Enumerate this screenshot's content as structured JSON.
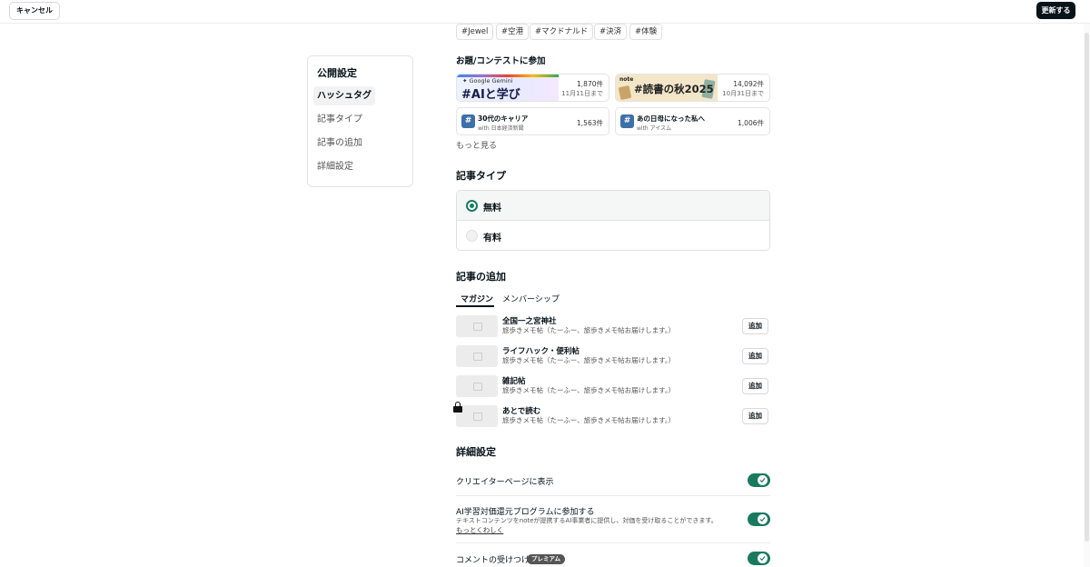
{
  "header": {
    "cancel_label": "キャンセル",
    "update_label": "更新する"
  },
  "sidebar": {
    "title": "公開設定",
    "items": [
      {
        "label": "ハッシュタグ",
        "active": true
      },
      {
        "label": "記事タイプ",
        "active": false
      },
      {
        "label": "記事の追加",
        "active": false
      },
      {
        "label": "詳細設定",
        "active": false
      }
    ]
  },
  "hashtags": [
    "#Jewel",
    "#空港",
    "#マクドナルド",
    "#決済",
    "#体験"
  ],
  "contests": {
    "title": "お題/コンテストに参加",
    "featured": [
      {
        "banner_sub": "Google Gemini",
        "banner_title": "#AIと学び",
        "count": "1,870件",
        "deadline": "11月11日まで"
      },
      {
        "banner_logo": "note",
        "banner_title": "#読書の秋2025",
        "count": "14,092件",
        "deadline": "10月31日まで"
      }
    ],
    "topics": [
      {
        "name": "30代のキャリア",
        "with": "with 日本経済新聞",
        "count": "1,563件"
      },
      {
        "name": "あの日母になった私へ",
        "with": "with アイスム",
        "count": "1,006件"
      }
    ],
    "more_label": "もっと見る"
  },
  "article_type": {
    "title": "記事タイプ",
    "options": [
      {
        "label": "無料",
        "selected": true
      },
      {
        "label": "有料",
        "selected": false
      }
    ]
  },
  "add_article": {
    "title": "記事の追加",
    "tabs": [
      {
        "label": "マガジン",
        "active": true
      },
      {
        "label": "メンバーシップ",
        "active": false
      }
    ],
    "add_label": "追加",
    "magazines": [
      {
        "title": "全国一之宮神社",
        "desc": "旅歩きメモ帖（たーふー、旅歩きメモ帖お届けします。）",
        "locked": false
      },
      {
        "title": "ライフハック・便利帖",
        "desc": "旅歩きメモ帖（たーふー、旅歩きメモ帖お届けします。）",
        "locked": false
      },
      {
        "title": "雑記帖",
        "desc": "旅歩きメモ帖（たーふー、旅歩きメモ帖お届けします。）",
        "locked": false
      },
      {
        "title": "あとで読む",
        "desc": "旅歩きメモ帖（たーふー、旅歩きメモ帖お届けします。）",
        "locked": true
      }
    ]
  },
  "details": {
    "title": "詳細設定",
    "creator_page": {
      "label": "クリエイターページに表示",
      "on": true
    },
    "ai_program": {
      "label": "AI学習対価還元プログラムに参加する",
      "desc": "テキストコンテンツをnoteが提携するAI事業者に提供し、対価を受け取ることができます。",
      "link": "もっとくわしく",
      "on": true
    },
    "comments": {
      "label": "コメントの受けつけ",
      "badge": "プレミアム",
      "on": true
    }
  },
  "colors": {
    "accent": "#1a7a60",
    "primary_button": "#08131a"
  }
}
